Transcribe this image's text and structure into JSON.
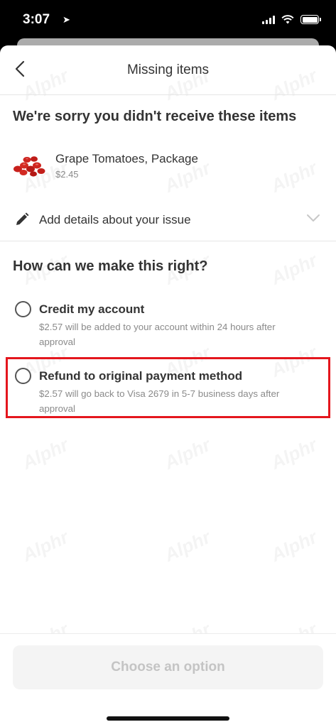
{
  "status_bar": {
    "time": "3:07"
  },
  "header": {
    "title": "Missing items"
  },
  "sorry_title": "We're sorry you didn't receive these items",
  "item": {
    "name": "Grape Tomatoes, Package",
    "price": "$2.45"
  },
  "details": {
    "label": "Add details about your issue"
  },
  "make_right_title": "How can we make this right?",
  "options": [
    {
      "title": "Credit my account",
      "description": "$2.57 will be added to your account within 24 hours after approval",
      "selected": false
    },
    {
      "title": "Refund to original payment method",
      "description": "$2.57 will go back to Visa 2679 in 5-7 business days after approval",
      "selected": false
    }
  ],
  "footer": {
    "button_label": "Choose an option"
  },
  "watermark_text": "Alphr",
  "colors": {
    "highlight_border": "#e4161d",
    "text_dark": "#343434",
    "text_muted": "#8a8a8a",
    "button_disabled_bg": "#f4f4f4",
    "button_disabled_text": "#c4c4c4"
  }
}
